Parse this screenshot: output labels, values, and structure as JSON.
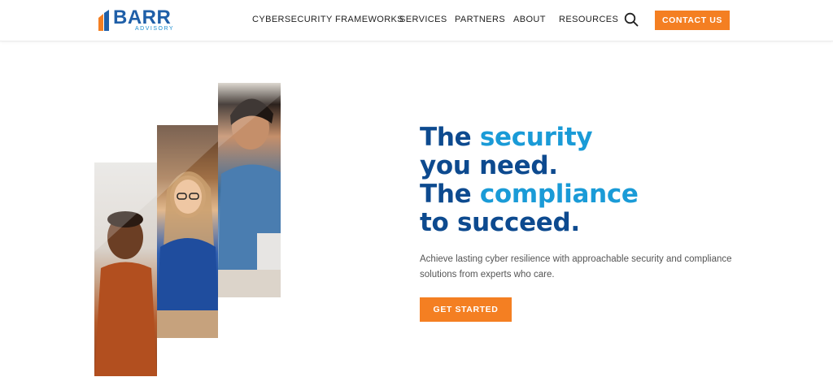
{
  "brand": {
    "name": "BARR",
    "sub": "ADVISORY",
    "colors": {
      "primary": "#1f5fa8",
      "accent": "#f47f22",
      "light": "#1a9bd7"
    }
  },
  "nav": {
    "items": [
      {
        "label": "CYBERSECURITY FRAMEWORKS"
      },
      {
        "label": "SERVICES"
      },
      {
        "label": "PARTNERS"
      },
      {
        "label": "ABOUT"
      },
      {
        "label": "RESOURCES"
      }
    ],
    "search_icon": "search-icon",
    "contact_label": "CONTACT US"
  },
  "hero": {
    "line1_a": "The ",
    "line1_b": "security",
    "line2": "you need.",
    "line3_a": "The ",
    "line3_b": "compliance",
    "line4": "to succeed.",
    "subtext": "Achieve lasting cyber resilience with approachable security and compliance solutions from experts who care.",
    "cta_label": "GET STARTED"
  }
}
